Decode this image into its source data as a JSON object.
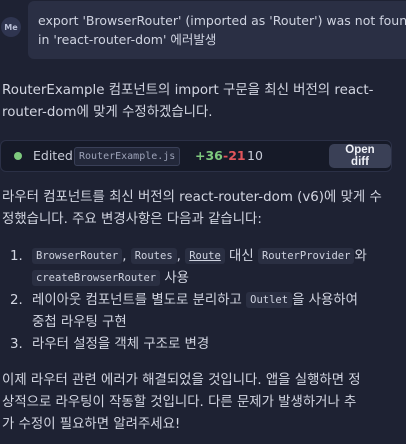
{
  "user_message": {
    "avatar_initials": "Me",
    "text_line1": "export 'BrowserRouter' (imported as 'Router') was not found",
    "text_line2": "in 'react-router-dom' 에러발생"
  },
  "intro": {
    "line1": "RouterExample 컴포넌트의 import 구문을 최신 버전의 react-",
    "line2": "router-dom에 맞게 수정하겠습니다."
  },
  "edit_card": {
    "status_icon": "green-dot-icon",
    "label": "Edited",
    "file": "RouterExample.js",
    "added": "+36",
    "removed": "-21",
    "count": "10",
    "button": "Open diff"
  },
  "summary": {
    "line1": "라우터 컴포넌트를 최신 버전의 react-router-dom (v6)에 맞게 수",
    "line2": "정했습니다. 주요 변경사항은 다음과 같습니다:"
  },
  "list": {
    "item1": {
      "num": "1.",
      "code1": "BrowserRouter",
      "sep1": ",",
      "code2": "Routes",
      "sep2": ",",
      "code3": "Route",
      "text1": " 대신 ",
      "code4": "RouterProvider",
      "text2": "와",
      "code5": "createBrowserRouter",
      "text3": " 사용"
    },
    "item2": {
      "num": "2.",
      "text1": "레이아웃 컴포넌트를 별도로 분리하고 ",
      "code1": "Outlet",
      "text2": "을 사용하여",
      "text3": "중첩 라우팅 구현"
    },
    "item3": {
      "num": "3.",
      "text1": "라우터 설정을 객체 구조로 변경"
    }
  },
  "closing": {
    "line1": "이제 라우터 관련 에러가 해결되었을 것입니다. 앱을 실행하면 정",
    "line2": "상적으로 라우팅이 작동할 것입니다. 다른 문제가 발생하거나 추",
    "line3": "가 수정이 필요하면 알려주세요!"
  },
  "colors": {
    "background": "#1e2233",
    "added": "#7ec97e",
    "removed": "#e2555b"
  }
}
